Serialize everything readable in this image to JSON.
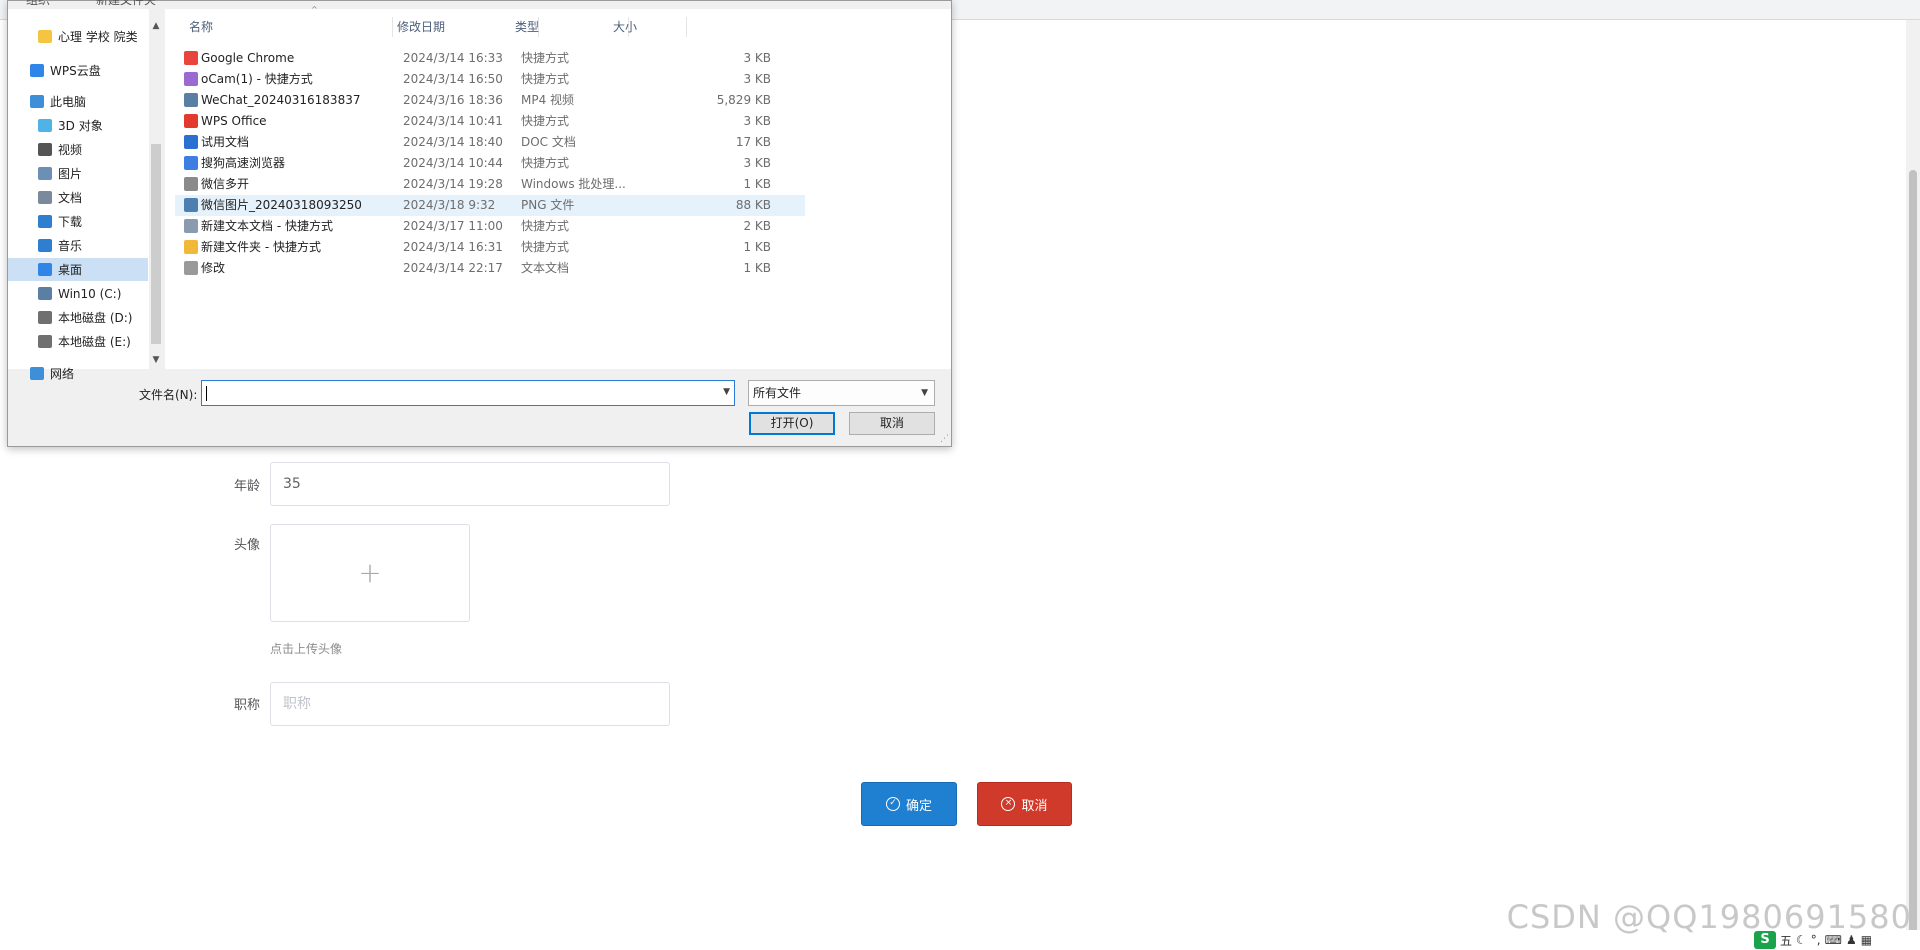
{
  "background_form": {
    "age_label": "年龄",
    "age_value": "35",
    "avatar_label": "头像",
    "upload_plus": "+",
    "upload_hint": "点击上传头像",
    "title_label": "职称",
    "title_placeholder": "职称",
    "confirm_label": "确定",
    "cancel_label": "取消"
  },
  "watermark": "CSDN @QQ1980691580",
  "tray": {
    "ime": "五",
    "logo": "S"
  },
  "dialog": {
    "top_partial_1": "组织",
    "top_partial_2": "新建文件夹",
    "nav": [
      {
        "label": "心理 学校 院类",
        "icon": "folder-icon",
        "color": "#f5c542"
      },
      {
        "label": "WPS云盘",
        "icon": "cloud-icon",
        "color": "#2f86e8"
      },
      {
        "label": "此电脑",
        "icon": "computer-icon",
        "color": "#3c8fd8"
      },
      {
        "label": "3D 对象",
        "icon": "cube-icon",
        "color": "#4fb3e8"
      },
      {
        "label": "视频",
        "icon": "video-icon",
        "color": "#555555"
      },
      {
        "label": "图片",
        "icon": "picture-icon",
        "color": "#6b8fb5"
      },
      {
        "label": "文档",
        "icon": "document-icon",
        "color": "#7a8a9c"
      },
      {
        "label": "下载",
        "icon": "download-icon",
        "color": "#2f7fd1"
      },
      {
        "label": "音乐",
        "icon": "music-icon",
        "color": "#2f7fd1"
      },
      {
        "label": "桌面",
        "icon": "desktop-icon",
        "color": "#2f86e8"
      },
      {
        "label": "Win10 (C:)",
        "icon": "drive-icon",
        "color": "#5b7fa3"
      },
      {
        "label": "本地磁盘 (D:)",
        "icon": "drive-icon",
        "color": "#707070"
      },
      {
        "label": "本地磁盘 (E:)",
        "icon": "drive-icon",
        "color": "#707070"
      },
      {
        "label": "网络",
        "icon": "network-icon",
        "color": "#3c8fd8"
      }
    ],
    "selected_nav": "桌面",
    "columns": [
      "名称",
      "修改日期",
      "类型",
      "大小"
    ],
    "files": [
      {
        "name": "Google Chrome",
        "date": "2024/3/14 16:33",
        "type": "快捷方式",
        "size": "3 KB",
        "icon": "chrome-icon",
        "color": "#e8453c"
      },
      {
        "name": "oCam(1) - 快捷方式",
        "date": "2024/3/14 16:50",
        "type": "快捷方式",
        "size": "3 KB",
        "icon": "ocam-icon",
        "color": "#9a6ad1"
      },
      {
        "name": "WeChat_20240316183837",
        "date": "2024/3/16 18:36",
        "type": "MP4 视频",
        "size": "5,829 KB",
        "icon": "video-file-icon",
        "color": "#5a7fa5"
      },
      {
        "name": "WPS Office",
        "date": "2024/3/14 10:41",
        "type": "快捷方式",
        "size": "3 KB",
        "icon": "wps-icon",
        "color": "#e23b2e"
      },
      {
        "name": "试用文档",
        "date": "2024/3/14 18:40",
        "type": "DOC 文档",
        "size": "17 KB",
        "icon": "doc-icon",
        "color": "#2b6fd1"
      },
      {
        "name": "搜狗高速浏览器",
        "date": "2024/3/14 10:44",
        "type": "快捷方式",
        "size": "3 KB",
        "icon": "sogou-icon",
        "color": "#3d7ee0"
      },
      {
        "name": "微信多开",
        "date": "2024/3/14 19:28",
        "type": "Windows 批处理...",
        "size": "1 KB",
        "icon": "bat-icon",
        "color": "#8a8a8a"
      },
      {
        "name": "微信图片_20240318093250",
        "date": "2024/3/18 9:32",
        "type": "PNG 文件",
        "size": "88 KB",
        "icon": "image-file-icon",
        "color": "#4d7fb0"
      },
      {
        "name": "新建文本文档 - 快捷方式",
        "date": "2024/3/17 11:00",
        "type": "快捷方式",
        "size": "2 KB",
        "icon": "text-shortcut-icon",
        "color": "#8a9bb0"
      },
      {
        "name": "新建文件夹 - 快捷方式",
        "date": "2024/3/14 16:31",
        "type": "快捷方式",
        "size": "1 KB",
        "icon": "folder-shortcut-icon",
        "color": "#f0b93a"
      },
      {
        "name": "修改",
        "date": "2024/3/14 22:17",
        "type": "文本文档",
        "size": "1 KB",
        "icon": "text-file-icon",
        "color": "#9a9a9a"
      }
    ],
    "hover_row": 7,
    "filename_label": "文件名(N):",
    "filename_value": "",
    "filetype_value": "所有文件",
    "open_label": "打开(O)",
    "cancel_label": "取消"
  }
}
